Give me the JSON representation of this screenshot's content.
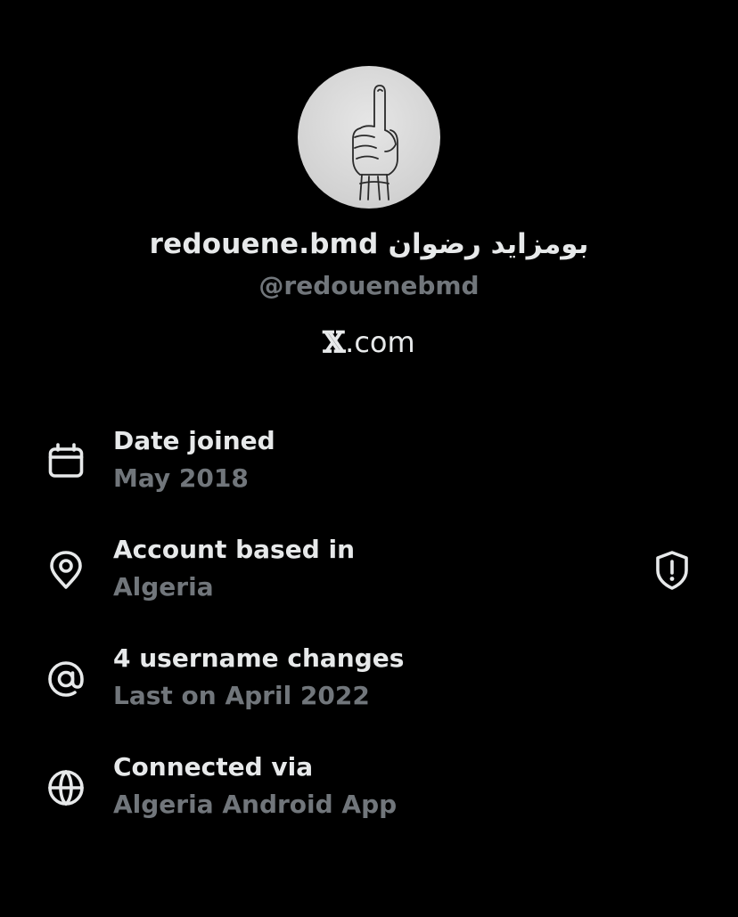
{
  "profile": {
    "display_name": "redouene.bmd بومزايد رضوان",
    "handle": "@redouenebmd",
    "domain_x": "𝕏",
    "domain_suffix": ".com"
  },
  "about": {
    "rows": [
      {
        "icon": "calendar-icon",
        "title": "Date joined",
        "value": "May 2018"
      },
      {
        "icon": "location-pin-icon",
        "title": "Account based in",
        "value": "Algeria"
      },
      {
        "icon": "at-sign-icon",
        "title": "4 username changes",
        "value": "Last on April 2022"
      },
      {
        "icon": "globe-icon",
        "title": "Connected via",
        "value": "Algeria Android App"
      }
    ],
    "location_action_icon": "shield-alert-icon"
  },
  "colors": {
    "background": "#000000",
    "primary_text": "#e7e9ea",
    "secondary_text": "#71767b"
  }
}
